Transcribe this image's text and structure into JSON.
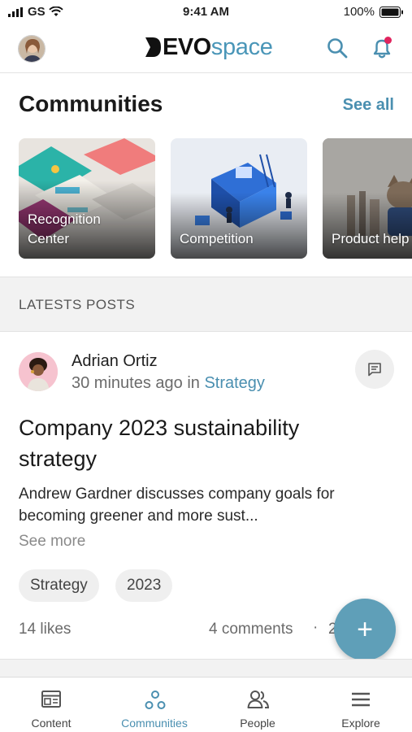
{
  "status_bar": {
    "carrier": "GS",
    "time": "9:41 AM",
    "battery": "100%"
  },
  "header": {
    "brand_bold": "EVO",
    "brand_light": "space",
    "notification_dot_color": "#e0245e",
    "accent_color": "#4a8fb0"
  },
  "communities": {
    "title": "Communities",
    "see_all": "See all",
    "cards": [
      {
        "label": "Recognition Center",
        "label_line1": "Recognition",
        "label_line2": "Center"
      },
      {
        "label": "Competition"
      },
      {
        "label": "Product help"
      }
    ]
  },
  "latest_posts": {
    "heading": "LATESTS POSTS"
  },
  "post": {
    "author": "Adrian Ortiz",
    "time_prefix": "30 minutes ago in ",
    "community": "Strategy",
    "title": "Company 2023 sustainability strategy",
    "excerpt": "Andrew Gardner discusses company goals for becoming greener and more sust...",
    "see_more": "See more",
    "tags": [
      "Strategy",
      "2023"
    ],
    "likes": "14 likes",
    "comments": "4 comments",
    "separator": "·",
    "extra": "2"
  },
  "fab": {
    "label": "+"
  },
  "bottom_nav": {
    "items": [
      {
        "label": "Content",
        "icon": "content-icon",
        "active": false
      },
      {
        "label": "Communities",
        "icon": "communities-icon",
        "active": true
      },
      {
        "label": "People",
        "icon": "people-icon",
        "active": false
      },
      {
        "label": "Explore",
        "icon": "menu-icon",
        "active": false
      }
    ]
  }
}
